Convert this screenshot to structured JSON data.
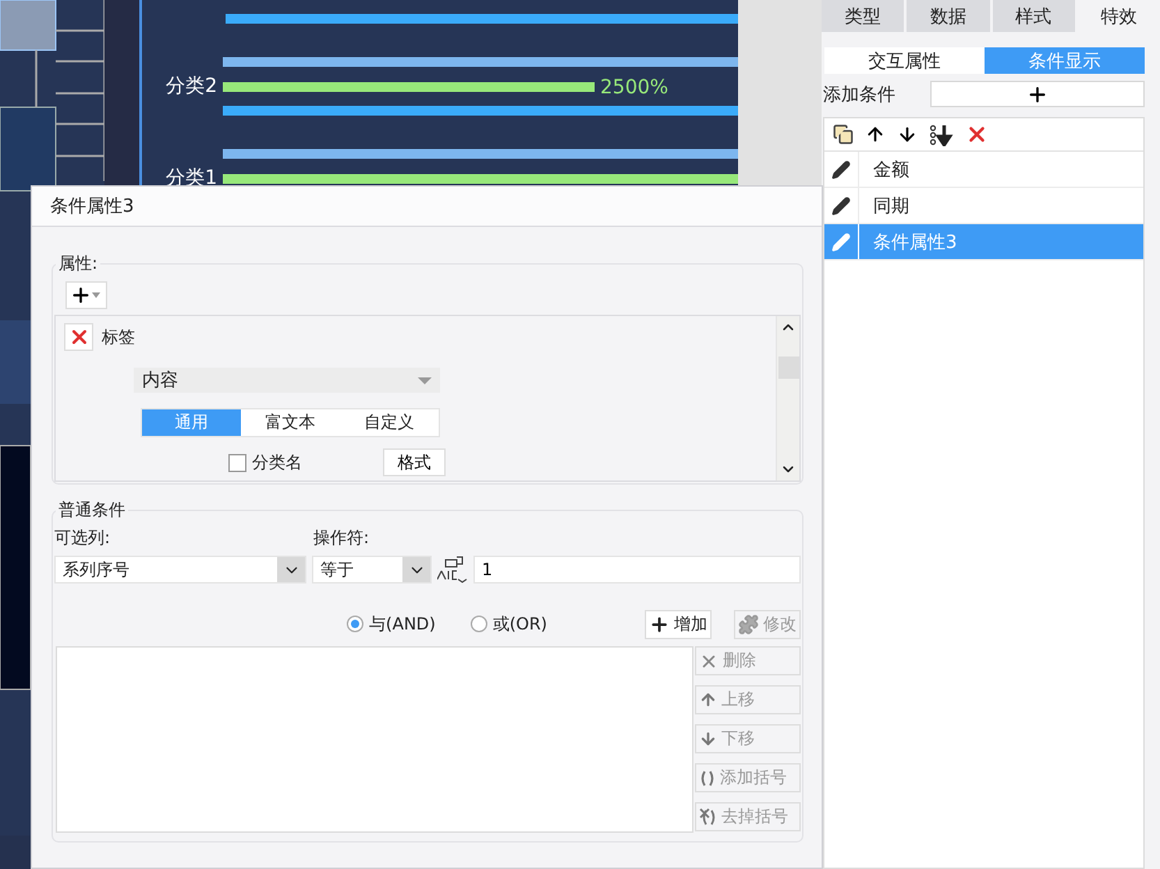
{
  "chart": {
    "rows": [
      {
        "label": "分类2",
        "value_label": "2500%",
        "kind": "partial"
      },
      {
        "label": "分类1",
        "kind": "full"
      }
    ]
  },
  "right_panel": {
    "tabs": [
      {
        "label": "类型",
        "selected": false
      },
      {
        "label": "数据",
        "selected": false
      },
      {
        "label": "样式",
        "selected": false
      },
      {
        "label": "特效",
        "selected": true
      }
    ],
    "subtabs": [
      {
        "label": "交互属性",
        "selected": false
      },
      {
        "label": "条件显示",
        "selected": true
      }
    ],
    "add_condition": {
      "label": "添加条件"
    },
    "conditions": [
      {
        "label": "金额",
        "selected": false
      },
      {
        "label": "同期",
        "selected": false
      },
      {
        "label": "条件属性3",
        "selected": true
      }
    ]
  },
  "dialog": {
    "title": "条件属性3",
    "attributes": {
      "legend": "属性:",
      "item_label": "标签",
      "dropdown_value": "内容",
      "tabs": [
        {
          "label": "通用",
          "selected": true
        },
        {
          "label": "富文本",
          "selected": false
        },
        {
          "label": "自定义",
          "selected": false
        }
      ],
      "checkbox": {
        "label": "分类名",
        "checked": false
      },
      "format_button": "格式"
    },
    "conditions": {
      "legend": "普通条件",
      "column_label": "可选列:",
      "operator_label": "操作符:",
      "column_value": "系列序号",
      "operator_value": "等于",
      "value": "1",
      "logic": [
        {
          "label": "与(AND)",
          "selected": true
        },
        {
          "label": "或(OR)",
          "selected": false
        }
      ],
      "buttons": [
        {
          "label": "增加",
          "kind": "add",
          "disabled": false
        },
        {
          "label": "修改",
          "kind": "edit",
          "disabled": true
        }
      ],
      "side_buttons": [
        {
          "label": "删除",
          "kind": "delete",
          "disabled": true
        },
        {
          "label": "上移",
          "kind": "up",
          "disabled": true
        },
        {
          "label": "下移",
          "kind": "down",
          "disabled": true
        },
        {
          "label": "添加括号",
          "kind": "add-brackets",
          "disabled": true
        },
        {
          "label": "去掉括号",
          "kind": "remove-brackets",
          "disabled": true
        }
      ]
    }
  }
}
